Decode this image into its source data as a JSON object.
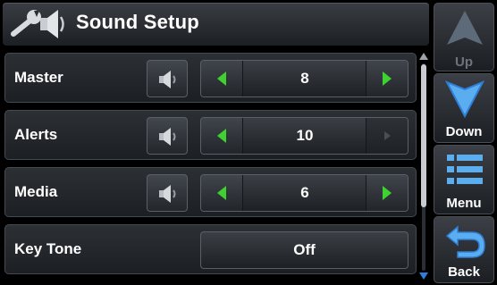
{
  "page": {
    "title": "Sound Setup",
    "title_icon": "wrench-speaker-icon"
  },
  "rows": [
    {
      "label": "Master",
      "value": "8",
      "has_speaker": true,
      "left_enabled": true,
      "right_enabled": true
    },
    {
      "label": "Alerts",
      "value": "10",
      "has_speaker": true,
      "left_enabled": true,
      "right_enabled": false
    },
    {
      "label": "Media",
      "value": "6",
      "has_speaker": true,
      "left_enabled": true,
      "right_enabled": true
    },
    {
      "label": "Key Tone",
      "value": "Off",
      "has_speaker": false
    }
  ],
  "side_buttons": {
    "up": {
      "label": "Up",
      "enabled": false
    },
    "down": {
      "label": "Down",
      "enabled": true
    },
    "menu": {
      "label": "Menu",
      "enabled": true
    },
    "back": {
      "label": "Back",
      "enabled": true
    }
  },
  "colors": {
    "accent_green": "#3fd12f",
    "disabled_arrow": "#4a4f56",
    "nav_blue": "#2f7fd8",
    "background": "#000000"
  }
}
